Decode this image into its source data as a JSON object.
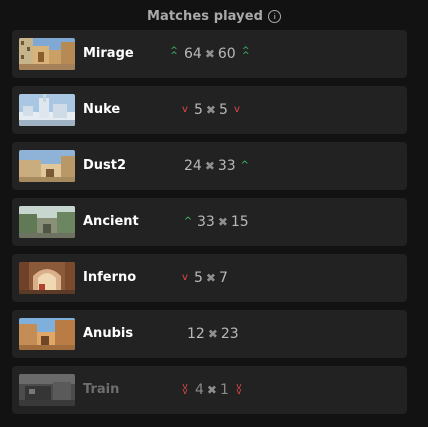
{
  "header": {
    "title": "Matches played",
    "info_icon": "info-icon"
  },
  "colors": {
    "background": "#121212",
    "row": "#222222",
    "up": "#3fc36a",
    "down": "#e04747"
  },
  "maps": [
    {
      "name": "Mirage",
      "left": "64",
      "right": "60",
      "left_trend": "double-up",
      "right_trend": "double-up"
    },
    {
      "name": "Nuke",
      "left": "5",
      "right": "5",
      "left_trend": "down",
      "right_trend": "down"
    },
    {
      "name": "Dust2",
      "left": "24",
      "right": "33",
      "left_trend": "none",
      "right_trend": "up"
    },
    {
      "name": "Ancient",
      "left": "33",
      "right": "15",
      "left_trend": "up",
      "right_trend": "none"
    },
    {
      "name": "Inferno",
      "left": "5",
      "right": "7",
      "left_trend": "down",
      "right_trend": "none"
    },
    {
      "name": "Anubis",
      "left": "12",
      "right": "23",
      "left_trend": "none",
      "right_trend": "none"
    },
    {
      "name": "Train",
      "left": "4",
      "right": "1",
      "left_trend": "double-down",
      "right_trend": "double-down"
    }
  ]
}
